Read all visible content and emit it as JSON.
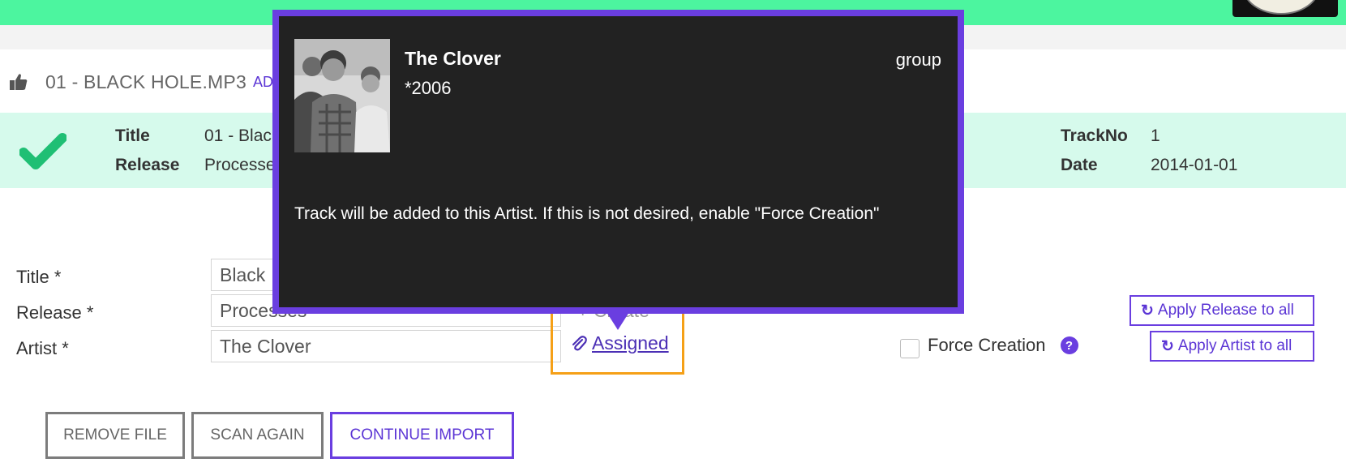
{
  "file": {
    "name": "01 - BLACK HOLE.MP3",
    "admin_link": "ADM"
  },
  "meta": {
    "title_label": "Title",
    "title_value": "01 - Blac",
    "release_label": "Release",
    "release_value": "Processe",
    "trackno_label": "TrackNo",
    "trackno_value": "1",
    "date_label": "Date",
    "date_value": "2014-01-01"
  },
  "form": {
    "title_label": "Title *",
    "title_value": "Black",
    "release_label": "Release *",
    "release_value": "Processes",
    "artist_label": "Artist *",
    "artist_value": "The Clover",
    "create_hint": "+ Create",
    "assigned_label": "Assigned",
    "force_label": "Force Creation",
    "help_glyph": "?",
    "apply_release_label": "Apply Release to all",
    "apply_artist_label": "Apply Artist to all"
  },
  "actions": {
    "remove_label": "REMOVE FILE",
    "scan_label": "SCAN AGAIN",
    "continue_label": "CONTINUE IMPORT"
  },
  "popover": {
    "artist_name": "The Clover",
    "years": "*2006",
    "type": "group",
    "message": "Track will be added to this Artist. If this is not desired, enable \"Force Creation\""
  },
  "icons": {
    "header": "thumbs-up-icon",
    "status": "check-icon",
    "assigned": "paperclip-icon",
    "help": "question-circle-icon",
    "apply": "refresh-icon"
  },
  "colors": {
    "top_bar": "#4cf59f",
    "meta_band": "#d6faec",
    "accent": "#6a3ee0",
    "highlight": "#f5a017",
    "check": "#1fbf74",
    "popover_bg": "#222222"
  }
}
